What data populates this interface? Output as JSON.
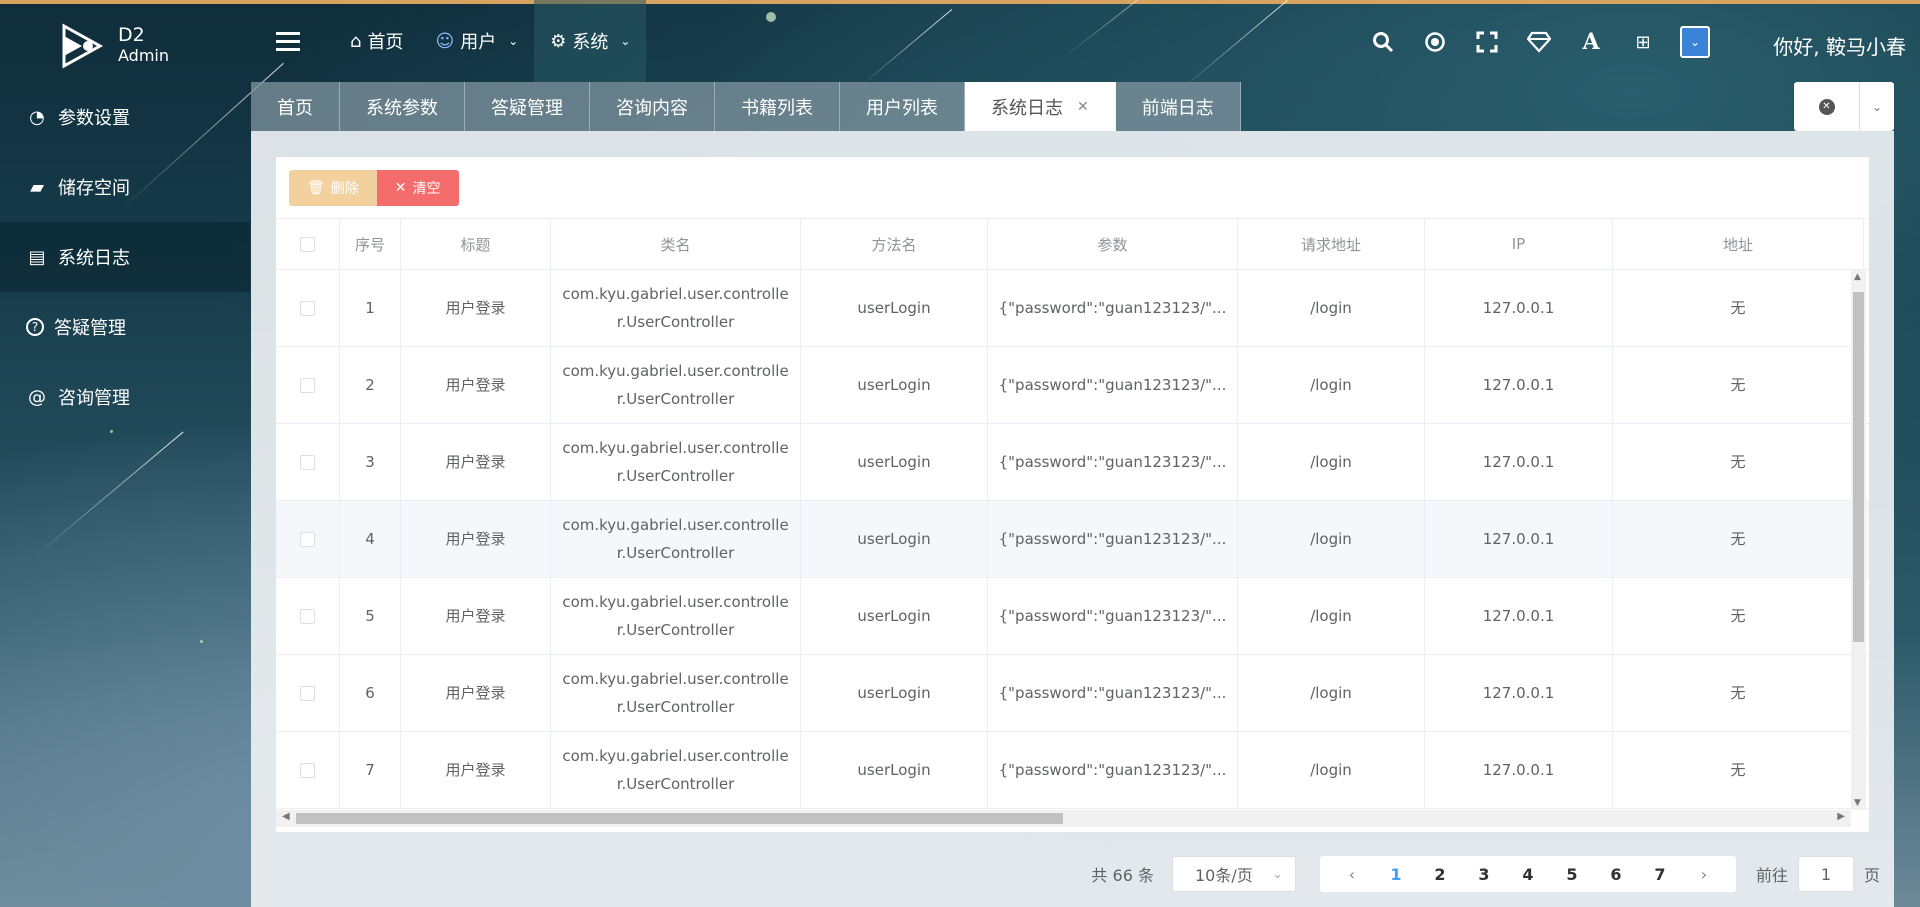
{
  "brand": {
    "name": "D2",
    "sub": "Admin"
  },
  "topmenu": [
    {
      "icon": "home-icon",
      "glyph": "⌂",
      "label": "首页",
      "chevron": false
    },
    {
      "icon": "user-icon",
      "glyph": "☺",
      "label": "用户",
      "chevron": true
    },
    {
      "icon": "gear-icon",
      "glyph": "⚙",
      "label": "系统",
      "chevron": true
    }
  ],
  "header": {
    "greeting": "你好, 鞍马小春"
  },
  "sidebar": {
    "items": [
      {
        "icon": "pie-chart-icon",
        "glyph": "◔",
        "label": "参数设置"
      },
      {
        "icon": "folder-open-icon",
        "glyph": "▰",
        "label": "储存空间"
      },
      {
        "icon": "file-text-icon",
        "glyph": "▤",
        "label": "系统日志"
      },
      {
        "icon": "question-circle-icon",
        "glyph": "?",
        "label": "答疑管理"
      },
      {
        "icon": "at-icon",
        "glyph": "@",
        "label": "咨询管理"
      }
    ]
  },
  "tabs": [
    {
      "label": "首页"
    },
    {
      "label": "系统参数"
    },
    {
      "label": "答疑管理"
    },
    {
      "label": "咨询内容"
    },
    {
      "label": "书籍列表"
    },
    {
      "label": "用户列表"
    },
    {
      "label": "系统日志",
      "active": true,
      "closable": true
    },
    {
      "label": "前端日志"
    }
  ],
  "toolbar": {
    "delete_label": "删除",
    "clear_label": "清空"
  },
  "table": {
    "headers": [
      "",
      "序号",
      "标题",
      "类名",
      "方法名",
      "参数",
      "请求地址",
      "IP",
      "地址"
    ],
    "rows": [
      {
        "no": "1",
        "title": "用户登录",
        "class_name": "com.kyu.gabriel.user.controller.UserController",
        "method": "userLogin",
        "params": "{\"password\":\"guan123123/\"...",
        "url": "/login",
        "ip": "127.0.0.1",
        "address": "无"
      },
      {
        "no": "2",
        "title": "用户登录",
        "class_name": "com.kyu.gabriel.user.controller.UserController",
        "method": "userLogin",
        "params": "{\"password\":\"guan123123/\"...",
        "url": "/login",
        "ip": "127.0.0.1",
        "address": "无"
      },
      {
        "no": "3",
        "title": "用户登录",
        "class_name": "com.kyu.gabriel.user.controller.UserController",
        "method": "userLogin",
        "params": "{\"password\":\"guan123123/\"...",
        "url": "/login",
        "ip": "127.0.0.1",
        "address": "无"
      },
      {
        "no": "4",
        "title": "用户登录",
        "class_name": "com.kyu.gabriel.user.controller.UserController",
        "method": "userLogin",
        "params": "{\"password\":\"guan123123/\"...",
        "url": "/login",
        "ip": "127.0.0.1",
        "address": "无"
      },
      {
        "no": "5",
        "title": "用户登录",
        "class_name": "com.kyu.gabriel.user.controller.UserController",
        "method": "userLogin",
        "params": "{\"password\":\"guan123123/\"...",
        "url": "/login",
        "ip": "127.0.0.1",
        "address": "无"
      },
      {
        "no": "6",
        "title": "用户登录",
        "class_name": "com.kyu.gabriel.user.controller.UserController",
        "method": "userLogin",
        "params": "{\"password\":\"guan123123/\"...",
        "url": "/login",
        "ip": "127.0.0.1",
        "address": "无"
      },
      {
        "no": "7",
        "title": "用户登录",
        "class_name": "com.kyu.gabriel.user.controller.UserController",
        "method": "userLogin",
        "params": "{\"password\":\"guan123123/\"...",
        "url": "/login",
        "ip": "127.0.0.1",
        "address": "无"
      }
    ]
  },
  "pagination": {
    "total_label": "共 66 条",
    "page_size_label": "10条/页",
    "pages": [
      "1",
      "2",
      "3",
      "4",
      "5",
      "6",
      "7"
    ],
    "current_page": "1",
    "goto_label": "前往",
    "goto_value": "1",
    "page_unit": "页"
  },
  "colors": {
    "accent": "#409eff",
    "danger": "#f56c6c",
    "warning_light": "#f3d19e"
  }
}
